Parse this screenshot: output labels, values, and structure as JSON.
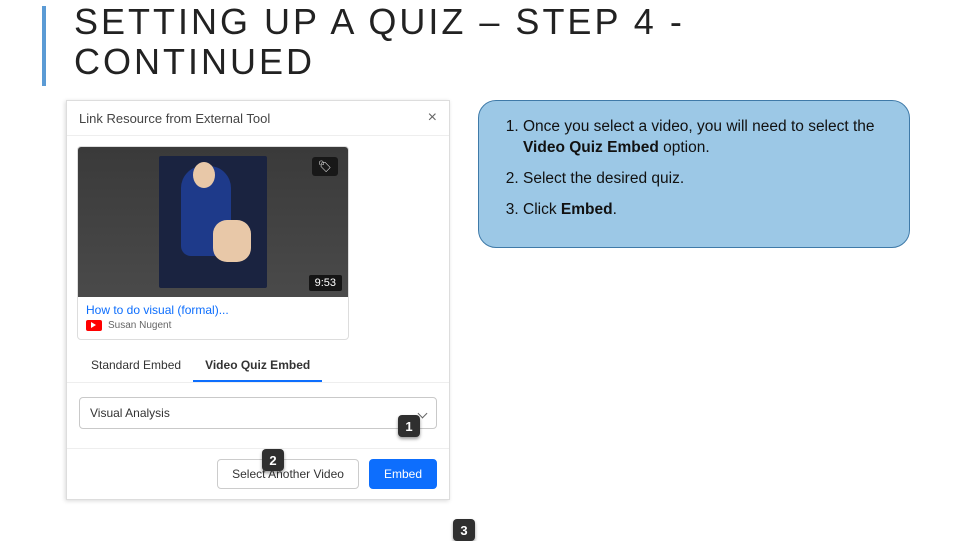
{
  "slide": {
    "title_line1": "SETTING UP A QUIZ – STEP 4 -",
    "title_line2": "CONTINUED"
  },
  "modal": {
    "title": "Link Resource from External Tool",
    "close_glyph": "×",
    "video": {
      "tag_glyph": "🏷",
      "duration": "9:53",
      "title": "How to do visual (formal)...",
      "channel": "Susan Nugent"
    },
    "tabs": {
      "standard": "Standard Embed",
      "video_quiz": "Video Quiz Embed"
    },
    "select": {
      "selected": "Visual Analysis"
    },
    "footer": {
      "select_another": "Select Another Video",
      "embed": "Embed"
    }
  },
  "callouts": {
    "one": "1",
    "two": "2",
    "three": "3"
  },
  "instructions": {
    "item1_pre": "Once you select a video, you will need to select the ",
    "item1_bold": "Video Quiz Embed",
    "item1_post": " option.",
    "item2": "Select the desired quiz.",
    "item3_pre": "Click ",
    "item3_bold": "Embed",
    "item3_post": "."
  }
}
